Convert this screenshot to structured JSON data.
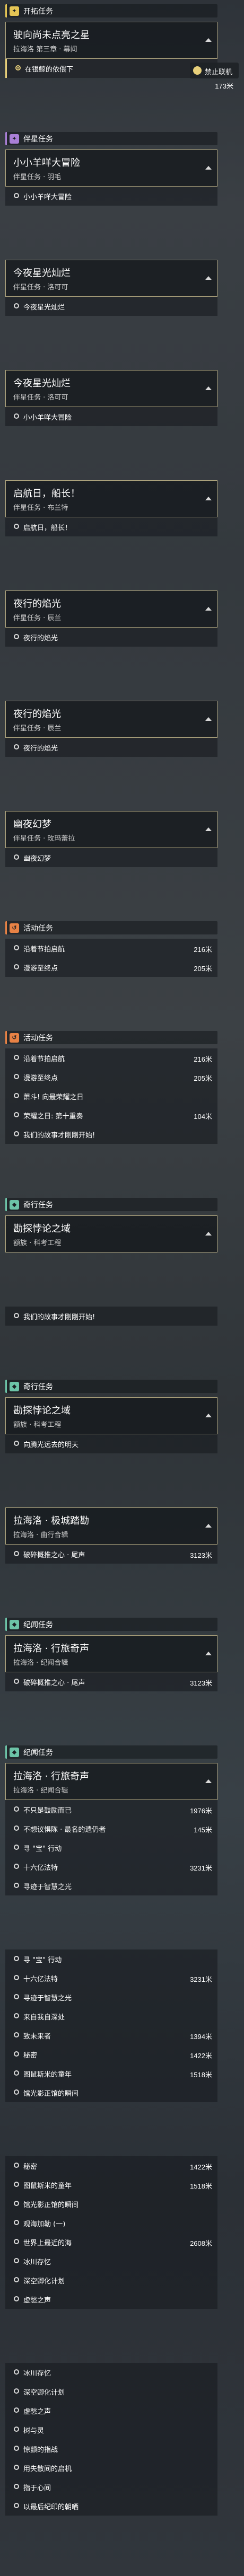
{
  "colors": {
    "main_quest": "#e5c555",
    "companion_quest": "#a97fd6",
    "event_quest": "#e88245",
    "adventure_quest": "#6cc3a7",
    "track_accent": "#e7cf7a"
  },
  "tracker": {
    "label": "禁止联机",
    "distance": "173米"
  },
  "quests": [
    {
      "category": "开拓任务",
      "category_icon": "star-icon",
      "title": "驶向尚未点亮之星",
      "subtitle": "拉海洛 第三章 · 幕间",
      "steps": [
        {
          "label": "在银鲸的依偎下",
          "active": true
        }
      ]
    },
    {
      "category": "伴星任务",
      "category_icon": "star-icon",
      "title": "小小羊咩大冒险",
      "subtitle": "伴星任务 · 羽毛",
      "steps": [
        {
          "label": "小小羊咩大冒险"
        }
      ]
    },
    {
      "title": "今夜星光灿烂",
      "subtitle": "伴星任务 · 洛可可",
      "steps": [
        {
          "label": "今夜星光灿烂"
        }
      ]
    },
    {
      "title": "今夜星光灿烂",
      "subtitle": "伴星任务 · 洛可可",
      "steps": [
        {
          "label": "小小羊咩大冒险"
        }
      ]
    },
    {
      "title": "启航日，船长！",
      "subtitle": "伴星任务 · 布兰特",
      "steps": [
        {
          "label": "启航日，船长！"
        }
      ]
    },
    {
      "title": "夜行的焰光",
      "subtitle": "伴星任务 · 辰兰",
      "steps": [
        {
          "label": "夜行的焰光"
        }
      ]
    },
    {
      "title": "夜行的焰光",
      "subtitle": "伴星任务 · 辰兰",
      "steps": [
        {
          "label": "夜行的焰光"
        }
      ]
    },
    {
      "title": "幽夜幻梦",
      "subtitle": "伴星任务 · 玫玛蕾拉",
      "steps": [
        {
          "label": "幽夜幻梦"
        }
      ]
    },
    {
      "category": "活动任务",
      "category_icon": "event-icon",
      "steps": [
        {
          "label": "沿着节拍启航",
          "distance": "216米"
        },
        {
          "label": "漫游至终点",
          "distance": "205米"
        }
      ]
    },
    {
      "category": "活动任务",
      "category_icon": "event-icon",
      "steps": [
        {
          "label": "沿着节拍启航",
          "distance": "216米"
        },
        {
          "label": "漫游至终点",
          "distance": "205米"
        },
        {
          "label": "萧斗! 向最荣耀之日"
        },
        {
          "label": "荣耀之日: 第十重奏",
          "distance": "104米"
        },
        {
          "label": "我们的故事才刚刚开始!"
        }
      ]
    },
    {
      "category": "奇行任务",
      "category_icon": "adventure-icon",
      "title": "勘探悖论之域",
      "subtitle": "额族 · 科考工程",
      "steps": []
    },
    {
      "steps": [
        {
          "label": "我们的故事才刚刚开始!"
        }
      ]
    },
    {
      "category": "奇行任务",
      "category_icon": "adventure-icon",
      "title": "勘探悖论之域",
      "subtitle": "额族 · 科考工程",
      "steps": [
        {
          "label": "向腾光远去的明天"
        }
      ]
    },
    {
      "title": "拉海洛 · 极城踏勘",
      "subtitle": "拉海洛 · 曲行合辑",
      "steps": [
        {
          "label": "破碎概推之心 · 尾声",
          "distance": "3123米"
        }
      ]
    },
    {
      "category": "纪闻任务",
      "category_icon": "adventure-icon",
      "title": "拉海洛 · 行旅奇声",
      "subtitle": "拉海洛 · 纪闻合辑",
      "steps": [
        {
          "label": "破碎概推之心 · 尾声",
          "distance": "3123米"
        }
      ]
    },
    {
      "category": "纪闻任务",
      "category_icon": "adventure-icon",
      "title": "拉海洛 · 行旅奇声",
      "subtitle": "拉海洛 · 纪闻合辑",
      "steps": [
        {
          "label": "不只是鼓励而已",
          "distance": "1976米"
        },
        {
          "label": "不想议惧陈 · 最名的遗仍者",
          "distance": "145米"
        },
        {
          "label": "寻 \"宝\" 行动"
        },
        {
          "label": "十六亿法特",
          "distance": "3231米"
        },
        {
          "label": "寻迹于智慧之光"
        }
      ]
    },
    {
      "steps": [
        {
          "label": "寻 \"宝\" 行动"
        },
        {
          "label": "十六亿法特",
          "distance": "3231米"
        },
        {
          "label": "寻迹于智慧之光"
        },
        {
          "label": "来自我自深处"
        },
        {
          "label": "致未来者",
          "distance": "1394米"
        },
        {
          "label": "秘密",
          "distance": "1422米"
        },
        {
          "label": "图鼠斯米的童年",
          "distance": "1518米"
        },
        {
          "label": "馆光影正馆的瞬间"
        }
      ]
    },
    {
      "steps": [
        {
          "label": "秘密",
          "distance": "1422米"
        },
        {
          "label": "图鼠斯米的童年",
          "distance": "1518米"
        },
        {
          "label": "馆光影正馆的瞬间"
        },
        {
          "label": "观海加勒 (一)"
        },
        {
          "label": "世界上最近的海",
          "distance": "2608米"
        },
        {
          "label": "冰川存忆"
        },
        {
          "label": "深空卿化计划"
        },
        {
          "label": "虚愁之声"
        }
      ]
    },
    {
      "steps": [
        {
          "label": "冰川存忆"
        },
        {
          "label": "深空卿化计划"
        },
        {
          "label": "虚愁之声"
        },
        {
          "label": "树与灵"
        },
        {
          "label": "惊颤的指战"
        },
        {
          "label": "用失散间的启机"
        },
        {
          "label": "指于心间"
        },
        {
          "label": "以最后纪印的朝晒"
        }
      ]
    }
  ]
}
